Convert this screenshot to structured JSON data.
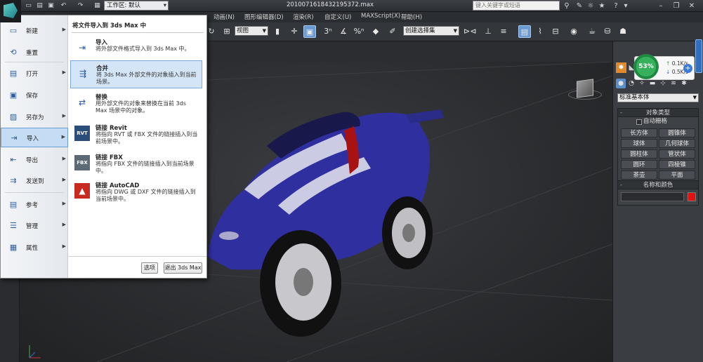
{
  "titlebar": {
    "workspace_label": "工作区: 默认",
    "doc_title": "2010071618432195372.max",
    "search_placeholder": "键入关键字或短语"
  },
  "menubar": {
    "items": [
      "动画(N)",
      "图形编辑器(D)",
      "渲染(R)",
      "自定义(U)",
      "MAXScript(X)",
      "帮助(H)"
    ]
  },
  "toolbar": {
    "view_dropdown": "视图",
    "selection_set_dropdown": "创建选择集",
    "snap_label": "3",
    "percent_label": "%"
  },
  "app_menu": {
    "left_items": [
      {
        "label": "新建",
        "icon": "new-icon",
        "arrow": true
      },
      {
        "label": "重置",
        "icon": "reset-icon",
        "arrow": false
      },
      {
        "label": "打开",
        "icon": "open-folder-icon",
        "arrow": true
      },
      {
        "label": "保存",
        "icon": "save-icon",
        "arrow": false
      },
      {
        "label": "另存为",
        "icon": "save-as-icon",
        "arrow": true
      },
      {
        "label": "导入",
        "icon": "import-icon",
        "arrow": true,
        "selected": true
      },
      {
        "label": "导出",
        "icon": "export-icon",
        "arrow": true
      },
      {
        "label": "发送到",
        "icon": "send-to-icon",
        "arrow": true
      },
      {
        "label": "参考",
        "icon": "reference-icon",
        "arrow": true
      },
      {
        "label": "管理",
        "icon": "manage-icon",
        "arrow": true
      },
      {
        "label": "属性",
        "icon": "properties-icon",
        "arrow": true
      }
    ],
    "right_header": "将文件导入到 3ds Max 中",
    "right_items": [
      {
        "title": "导入",
        "desc": "将外部文件格式导入到 3ds Max 中。",
        "icon": "import-icon"
      },
      {
        "title": "合并",
        "desc": "将 3ds Max 外部文件的对象插入到当前场景。",
        "icon": "merge-icon",
        "selected": true
      },
      {
        "title": "替换",
        "desc": "用外部文件的对象来替换在当前 3ds Max 场景中的对象。",
        "icon": "replace-icon"
      },
      {
        "title": "链接 Revit",
        "desc": "将指向 RVT 或 FBX 文件的链接插入到当前场景中。",
        "icon": "revit-icon"
      },
      {
        "title": "链接 FBX",
        "desc": "将指向 FBX 文件的链接插入到当前场景中。",
        "icon": "fbx-icon"
      },
      {
        "title": "链接 AutoCAD",
        "desc": "将指向 DWG 或 DXF 文件的链接插入到当前场景中。",
        "icon": "autocad-icon"
      }
    ],
    "options_button": "选项",
    "exit_button": "退出 3ds Max",
    "revit_chip": "RVT",
    "fbx_chip": "FBX"
  },
  "network": {
    "percent": "53%",
    "upload": "0.1K/s",
    "download": "0.5K/s"
  },
  "command_panel": {
    "category_dropdown": "标准基本体",
    "object_type_header": "对象类型",
    "auto_grid_label": "自动栅格",
    "primitives": [
      "长方体",
      "圆锥体",
      "球体",
      "几何球体",
      "圆柱体",
      "管状体",
      "圆环",
      "四棱锥",
      "茶壶",
      "平面"
    ],
    "name_color_header": "名称和颜色",
    "object_color": "#e31212"
  },
  "viewport": {
    "background": "#2d2f32",
    "car_body_color": "#2f2fa0",
    "stripe_color": "#e6e6ee"
  }
}
